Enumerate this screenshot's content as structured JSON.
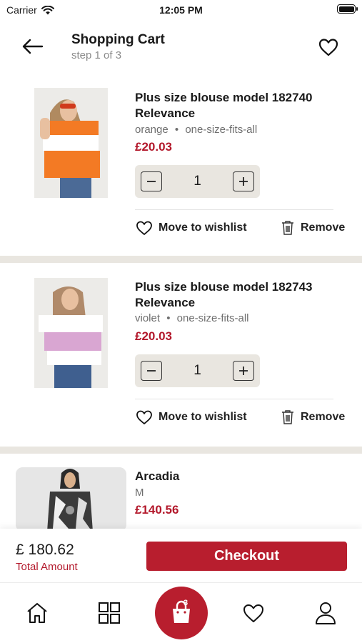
{
  "status_bar": {
    "carrier": "Carrier",
    "time": "12:05 PM"
  },
  "header": {
    "title": "Shopping Cart",
    "step": "step 1 of 3"
  },
  "items": [
    {
      "name": "Plus size blouse model 182740 Relevance",
      "color": "orange",
      "size": "one-size-fits-all",
      "price": "£20.03",
      "quantity": "1",
      "wishlist_label": "Move to wishlist",
      "remove_label": "Remove"
    },
    {
      "name": "Plus size blouse model 182743 Relevance",
      "color": "violet",
      "size": "one-size-fits-all",
      "price": "£20.03",
      "quantity": "1",
      "wishlist_label": "Move to wishlist",
      "remove_label": "Remove"
    },
    {
      "name": "Arcadia",
      "size": "M",
      "price": "£140.56"
    }
  ],
  "summary": {
    "total": "£ 180.62",
    "total_label": "Total Amount",
    "checkout_label": "Checkout"
  },
  "tabbar": {
    "cart_count": "3"
  },
  "colors": {
    "accent": "#b81e2e",
    "price": "#b3182b",
    "separator": "#e9e6e0"
  }
}
